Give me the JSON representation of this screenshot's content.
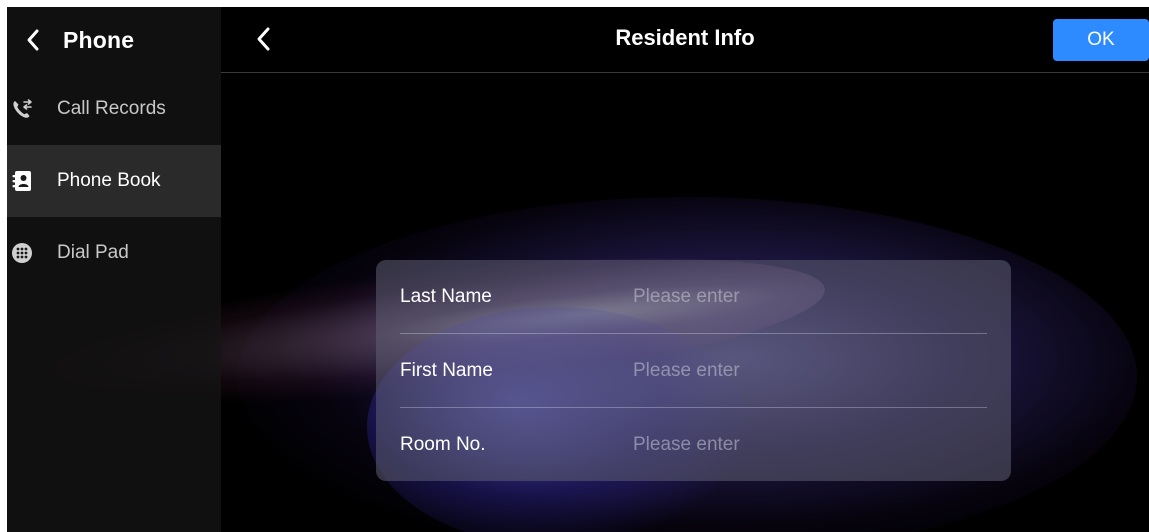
{
  "sidebar": {
    "title": "Phone",
    "items": [
      {
        "label": "Call Records",
        "icon": "call-records-icon",
        "active": false
      },
      {
        "label": "Phone Book",
        "icon": "phone-book-icon",
        "active": true
      },
      {
        "label": "Dial Pad",
        "icon": "dial-pad-icon",
        "active": false
      }
    ]
  },
  "header": {
    "title": "Resident Info",
    "ok_label": "OK"
  },
  "form": {
    "fields": [
      {
        "label": "Last Name",
        "value": "",
        "placeholder": "Please enter"
      },
      {
        "label": "First Name",
        "value": "",
        "placeholder": "Please enter"
      },
      {
        "label": "Room No.",
        "value": "",
        "placeholder": "Please enter"
      }
    ]
  },
  "colors": {
    "accent": "#2e8bff",
    "background": "#000000",
    "sidebar_active": "#2a2a2a"
  }
}
